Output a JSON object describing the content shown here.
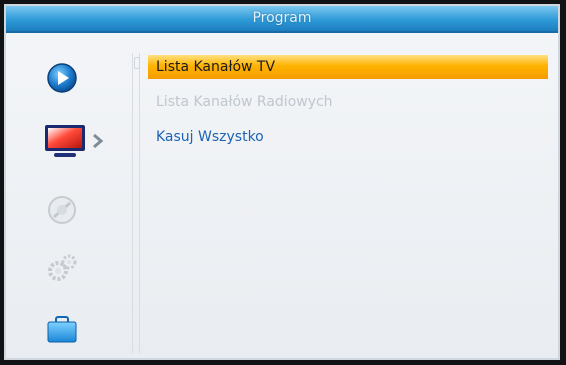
{
  "window": {
    "title": "Program"
  },
  "sidebar": {
    "items": [
      {
        "icon": "play-icon"
      },
      {
        "icon": "tv-icon",
        "active": true
      },
      {
        "icon": "satellite-dish-icon"
      },
      {
        "icon": "settings-gears-icon"
      },
      {
        "icon": "briefcase-icon"
      }
    ]
  },
  "menu": {
    "items": [
      {
        "label": "Lista Kanałów TV",
        "state": "selected"
      },
      {
        "label": "Lista Kanałów Radiowych",
        "state": "disabled"
      },
      {
        "label": "Kasuj Wszystko",
        "state": "normal"
      }
    ]
  },
  "colors": {
    "title_bar": "#2e9ad8",
    "selection": "#ffb300",
    "item_text": "#1c63b4",
    "disabled_text": "#bfc7cf"
  }
}
